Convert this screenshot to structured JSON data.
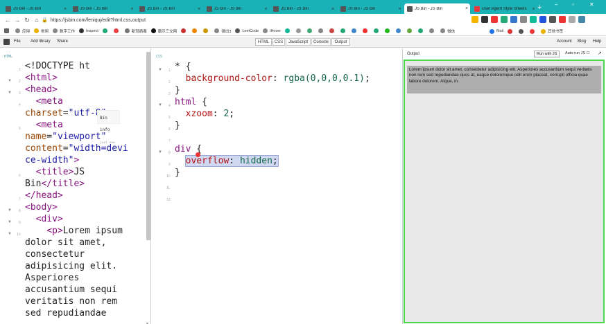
{
  "browser": {
    "tabs": [
      {
        "title": "JS Bin - JS Bin",
        "active": false
      },
      {
        "title": "JS Bin - JS Bin",
        "active": false
      },
      {
        "title": "JS Bin - JS Bin",
        "active": false
      },
      {
        "title": "JS Bin - JS Bin",
        "active": false
      },
      {
        "title": "JS Bin - JS Bin",
        "active": false
      },
      {
        "title": "JS Bin - JS Bin",
        "active": false
      },
      {
        "title": "JS Bin - JS Bin",
        "active": true
      },
      {
        "title": "User Agent Style Sheets",
        "active": false
      }
    ],
    "url": "https://jsbin.com/feniquj/edit?html,css,output",
    "bookmarks": [
      "应用",
      "常用",
      "数字工作",
      "Inspect",
      "",
      "",
      "新冠病毒",
      "霸示三交网",
      "",
      "",
      "",
      "弹出3",
      "LeetCode",
      "iHover",
      "",
      "",
      "",
      "",
      "",
      "",
      "",
      "",
      "",
      "",
      "",
      "",
      "",
      "",
      "微信"
    ],
    "bookmarks_right": [
      "Mail",
      "",
      "",
      "",
      "其他书签"
    ],
    "colors": {
      "tabbar": "#1bb2b7",
      "output_border": "#48d848"
    }
  },
  "jsbin": {
    "file_menu": "File",
    "add_library": "Add library",
    "share": "Share",
    "panels": [
      "HTML",
      "CSS",
      "JavaScript",
      "Console",
      "Output"
    ],
    "account": "Account",
    "blog": "Blog",
    "help": "Help"
  },
  "html_panel": {
    "label": "HTML",
    "bin_info": {
      "title": "Bin info",
      "sub": "just now"
    }
  },
  "css_panel": {
    "label": "CSS"
  },
  "output_panel": {
    "label": "Output",
    "run_button": "Run with JS",
    "autorun": "Auto-run JS",
    "text": "Lorem ipsum dolor sit amet, consectetur adipisicing elit. Asperiores accusantium sequi veritatis non rem sed repudiandae quos at, eaque doloremque odit enim placeat, corrupti officia quae labore dolorem. Atque, in."
  }
}
